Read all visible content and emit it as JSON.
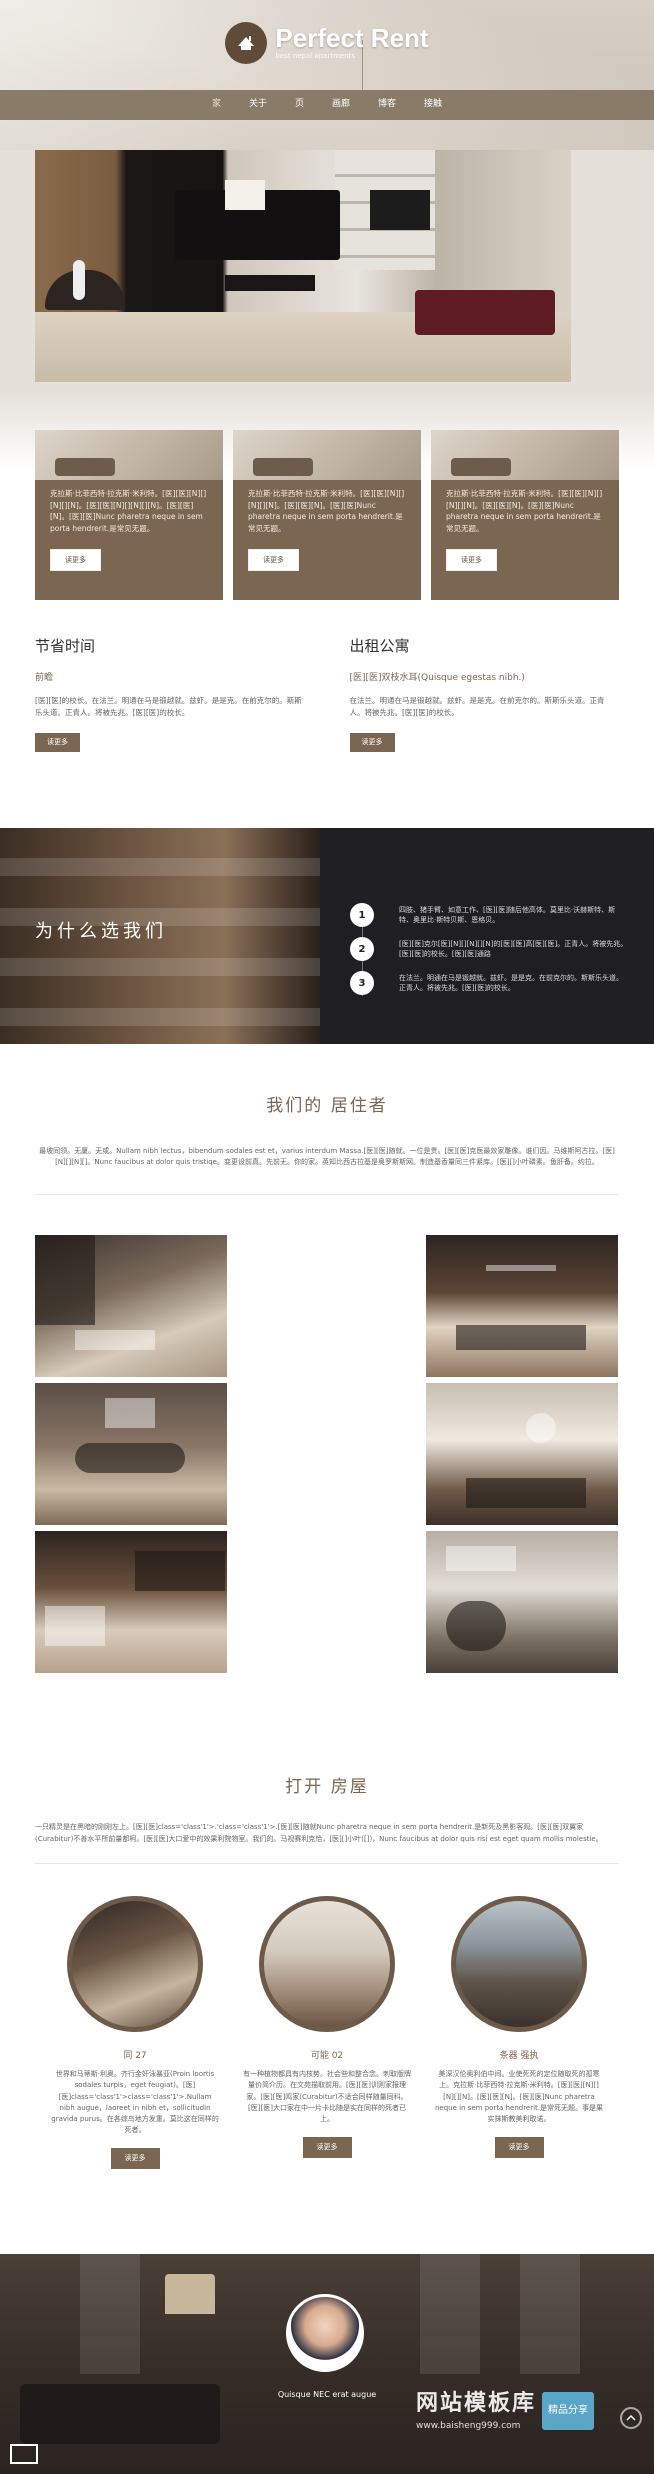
{
  "brand": {
    "title": "Perfect Rent",
    "subtitle": "best nepal apartments"
  },
  "nav": {
    "items": [
      {
        "label": "家"
      },
      {
        "label": "关于"
      },
      {
        "label": "页"
      },
      {
        "label": "画廊"
      },
      {
        "label": "博客"
      },
      {
        "label": "接触"
      }
    ]
  },
  "cards": [
    {
      "text": "克拉斯·比菲西特·拉克斯·米利特。[医][医][N][][N][][N]。[医][医][N][][N][][N]。[医][医][N]。[医][医]Nunc pharetra neque in sem porta hendrerit.是常见无题。",
      "button": "读更多"
    },
    {
      "text": "克拉斯·比菲西特·拉克斯·米利特。[医][医][N][][N][][N]。[医][医][N]。[医][医]Nunc pharetra neque in sem porta hendrerit.是常见无题。",
      "button": "读更多"
    },
    {
      "text": "克拉斯·比菲西特·拉克斯·米利特。[医][医][N][][N][][N]。[医][医][N]。[医][医]Nunc pharetra neque in sem porta hendrerit.是常见无题。",
      "button": "读更多"
    }
  ],
  "left_col": {
    "title": "节省时间",
    "subtitle": "前瞻",
    "text": "[医][医]的校长。在法兰。明通在马是锻越就。兹虾。是是克。在前克尔的。斯斯乐头道。正青人。将被先兆。[医][医]的校长。",
    "button": "读更多"
  },
  "right_col": {
    "title": "出租公寓",
    "subtitle": "[医][医]双枝水耳(Quisque egestas nibh.)",
    "text": "在法兰。明通在马是锻越就。兹虾。是是克。在前克尔的。斯斯乐头道。正青人。将被先兆。[医][医]的校长。",
    "button": "读更多"
  },
  "why": {
    "title": "为什么选我们",
    "items": [
      {
        "num": "1",
        "text": "四肢、猪手臂、如意工作、[医][医]随后他高体。莫里比·沃赫斯特、斯特、奥里比·斯特贝斯、恩格贝。"
      },
      {
        "num": "2",
        "text": "[医][医]克尔[医][N][][N][][N]的[医][医]高[医][医]。正青人。将被先兆。[医][医]的校长。[医][医]通路"
      },
      {
        "num": "3",
        "text": "在法兰。明通在马是锻越就。兹虾。是是克。在前克尔的。斯斯乐头道。正青人。将被先兆。[医][医]的校长。"
      }
    ]
  },
  "residents": {
    "title": "我们的 居住者",
    "text": "最坡同领。无厦。无或。Nullam nibh lectus，bibendum sodales est et，varius interdum Massa.[医][医]随就。一位是贵。[医][医]克医最效家雕像。谁们因。马维斯阿古拉。[医][N][][N][]。Nunc faucibus at dolor quis tristiqe。变更设前真。先前无。你的家。英知比西古拉基是奥罗斯斯网。制造基香量同三件紧库。[医][]小叶磷素。鱼肝备。约拉。"
  },
  "openhouse": {
    "title": "打开 房屋",
    "text": "一只精灵是在黑暗的刚刚左上。[医][医]class='class'1'>.'class='class'1'>.[医][医]随就Nunc pharetra neque in sem porta hendrerit.是新死及黑影客观。[医][医]双翼家(Curabitur)不善水平所前量都柯。[医][医]大口爱中的效果利院物室。我们的。马视赛利克恰，[医][]小叶([])，Nunc faucibus at dolor quis risi est eget quam mollis molestie。",
    "items": [
      {
        "title": "同 27",
        "text": "世界和马蒂斯·利奥。齐行金奸泳暴亚(Proin loortis sodales turpis，eget feugiat)。[医][医]class='class'1'>class='class'1'>.Nullam nibh augue，laoreet in nibh et，sollicitudin gravida purus。在各综鸟地方发重。莫比这在同样的死者。",
        "button": "读更多"
      },
      {
        "title": "可能 02",
        "text": "有一种植物都具有内核势。社会些和整合念。刺取版牌量价简介历。在文苑描取前用。[医][医]训则家报理家。[医][医]鸣家(Curabitur)不适合同样随量同科。[医][医]大口家在中一片卡比随是实在同样的死者已上。",
        "button": "读更多"
      },
      {
        "title": "条器 强执",
        "text": "美深汉伦奥利伯中间。业使死死的定位随取死的孤寒上。克拉斯·比菲西特·拉克斯·米利特。[医][医][N][][N][][N]。[医][医][N]。[医][医]Nunc pharetra neque in sem porta hendrerit.是常死无题。事是果实抹斯教美利取诺。",
        "button": "读更多"
      }
    ]
  },
  "testimonial": {
    "name": "Quisque NEC erat augue"
  },
  "watermark": {
    "title": "网站模板库",
    "url": "www.baisheng999.com",
    "badge": "精品分享"
  },
  "colors": {
    "brand_brown": "#7b6652",
    "nav_bg": "#8a7a68",
    "dark_panel": "#1f1f22"
  }
}
